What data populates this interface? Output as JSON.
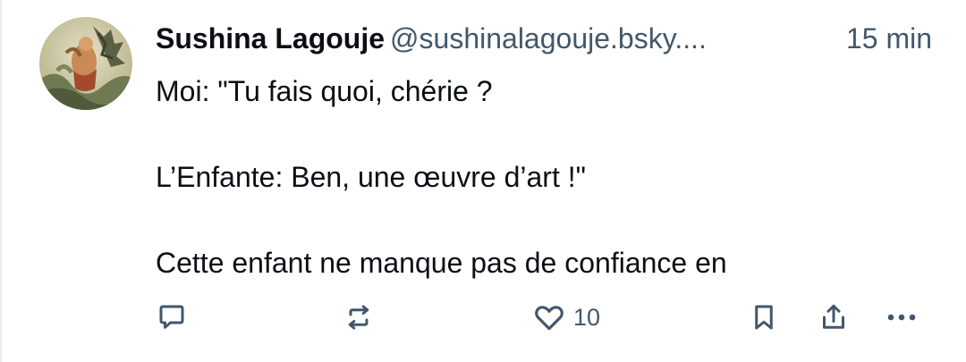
{
  "post": {
    "author_name": "Sushina Lagouje",
    "author_handle": "@sushinalagouje.bsky....",
    "time": "15 min",
    "lines": [
      "Moi: \"Tu fais quoi, chérie ?",
      "L’Enfante: Ben, une œuvre d’art !\"",
      "Cette enfant ne manque pas de confiance en"
    ]
  },
  "actions": {
    "reply_icon": "speech-bubble-icon",
    "repost_icon": "repost-arrows-icon",
    "like_icon": "heart-icon",
    "like_count": "10",
    "bookmark_icon": "bookmark-icon",
    "share_icon": "share-upload-icon",
    "more_icon": "ellipsis-icon"
  },
  "colors": {
    "text": "#0b0f14",
    "muted": "#42576c",
    "icon": "#42576c"
  }
}
